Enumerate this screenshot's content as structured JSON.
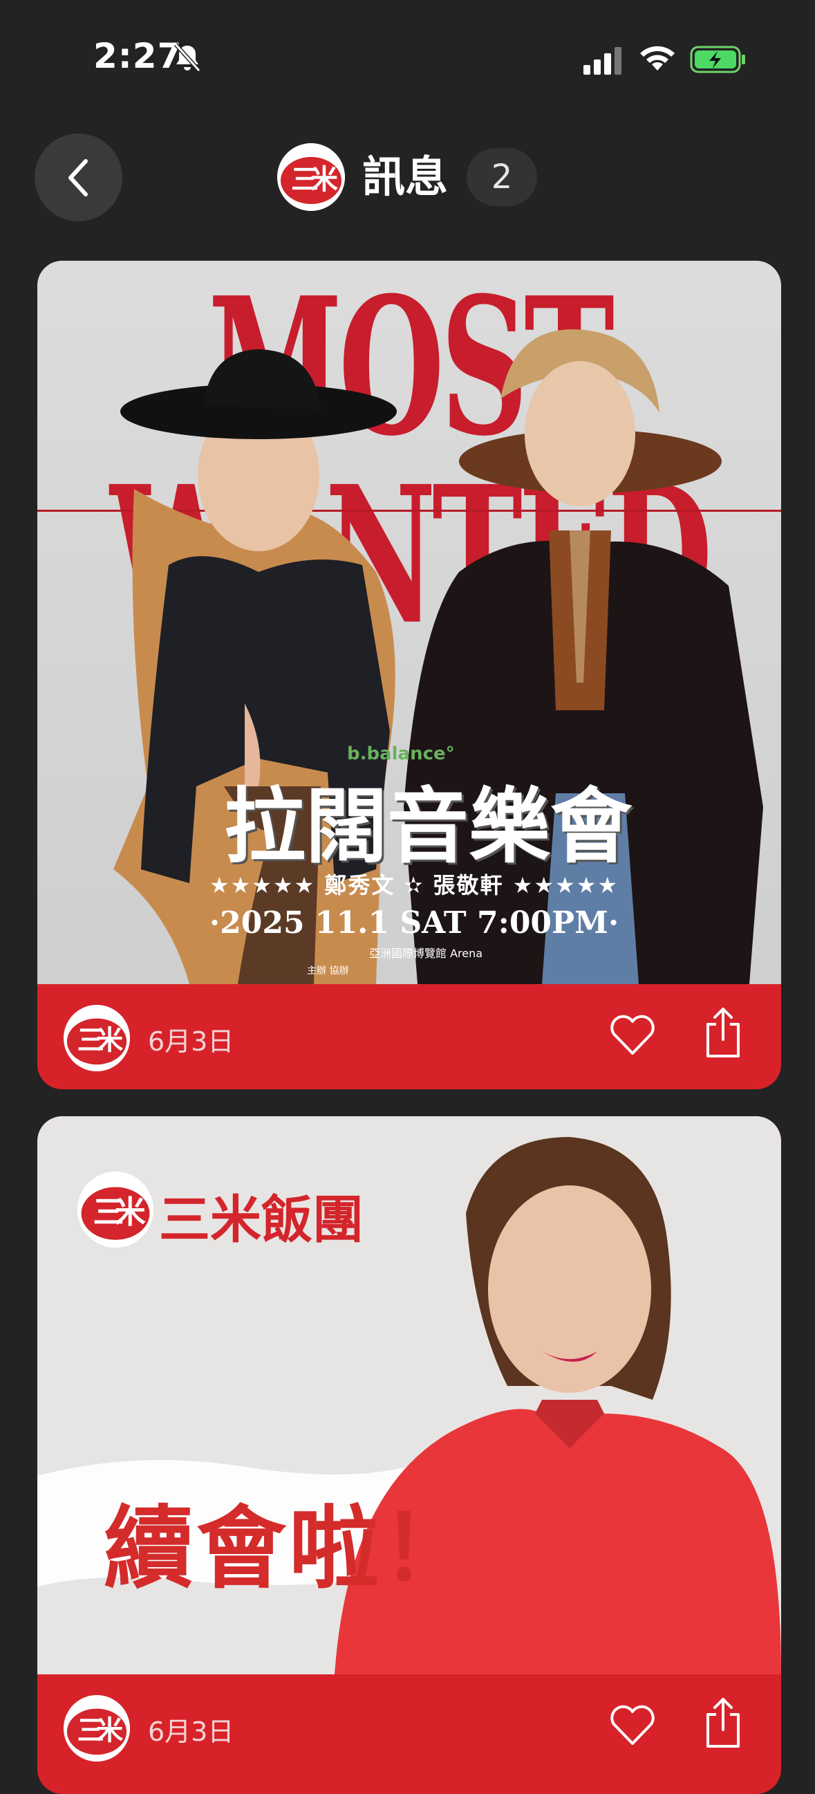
{
  "status_bar": {
    "time": "2:27",
    "icons": [
      "bell-slash-icon",
      "cellular-signal-icon",
      "wifi-icon",
      "battery-charging-icon"
    ]
  },
  "header": {
    "back_icon": "chevron-left-icon",
    "title": "訊息",
    "count": "2"
  },
  "messages": [
    {
      "date": "6月3日",
      "poster": {
        "headline": "MOST WANTED",
        "sponsor": "b.balance°",
        "title": "拉闊音樂會",
        "artists": "★★★★★ 鄭秀文 ✫ 張敬軒 ★★★★★",
        "datetime": "·2025 11.1 SAT 7:00PM·",
        "venue": "亞洲國際博覽館 Arena",
        "sponsors_row": "主辦  協辦"
      },
      "actions": [
        "heart-icon",
        "share-icon"
      ]
    },
    {
      "date": "6月3日",
      "poster": {
        "brand": "三米飯團",
        "caption": "續會啦！"
      },
      "actions": [
        "heart-icon",
        "share-icon"
      ]
    }
  ],
  "colors": {
    "background": "#232323",
    "card_red": "#d8222a",
    "brand_red": "#d3252b"
  }
}
